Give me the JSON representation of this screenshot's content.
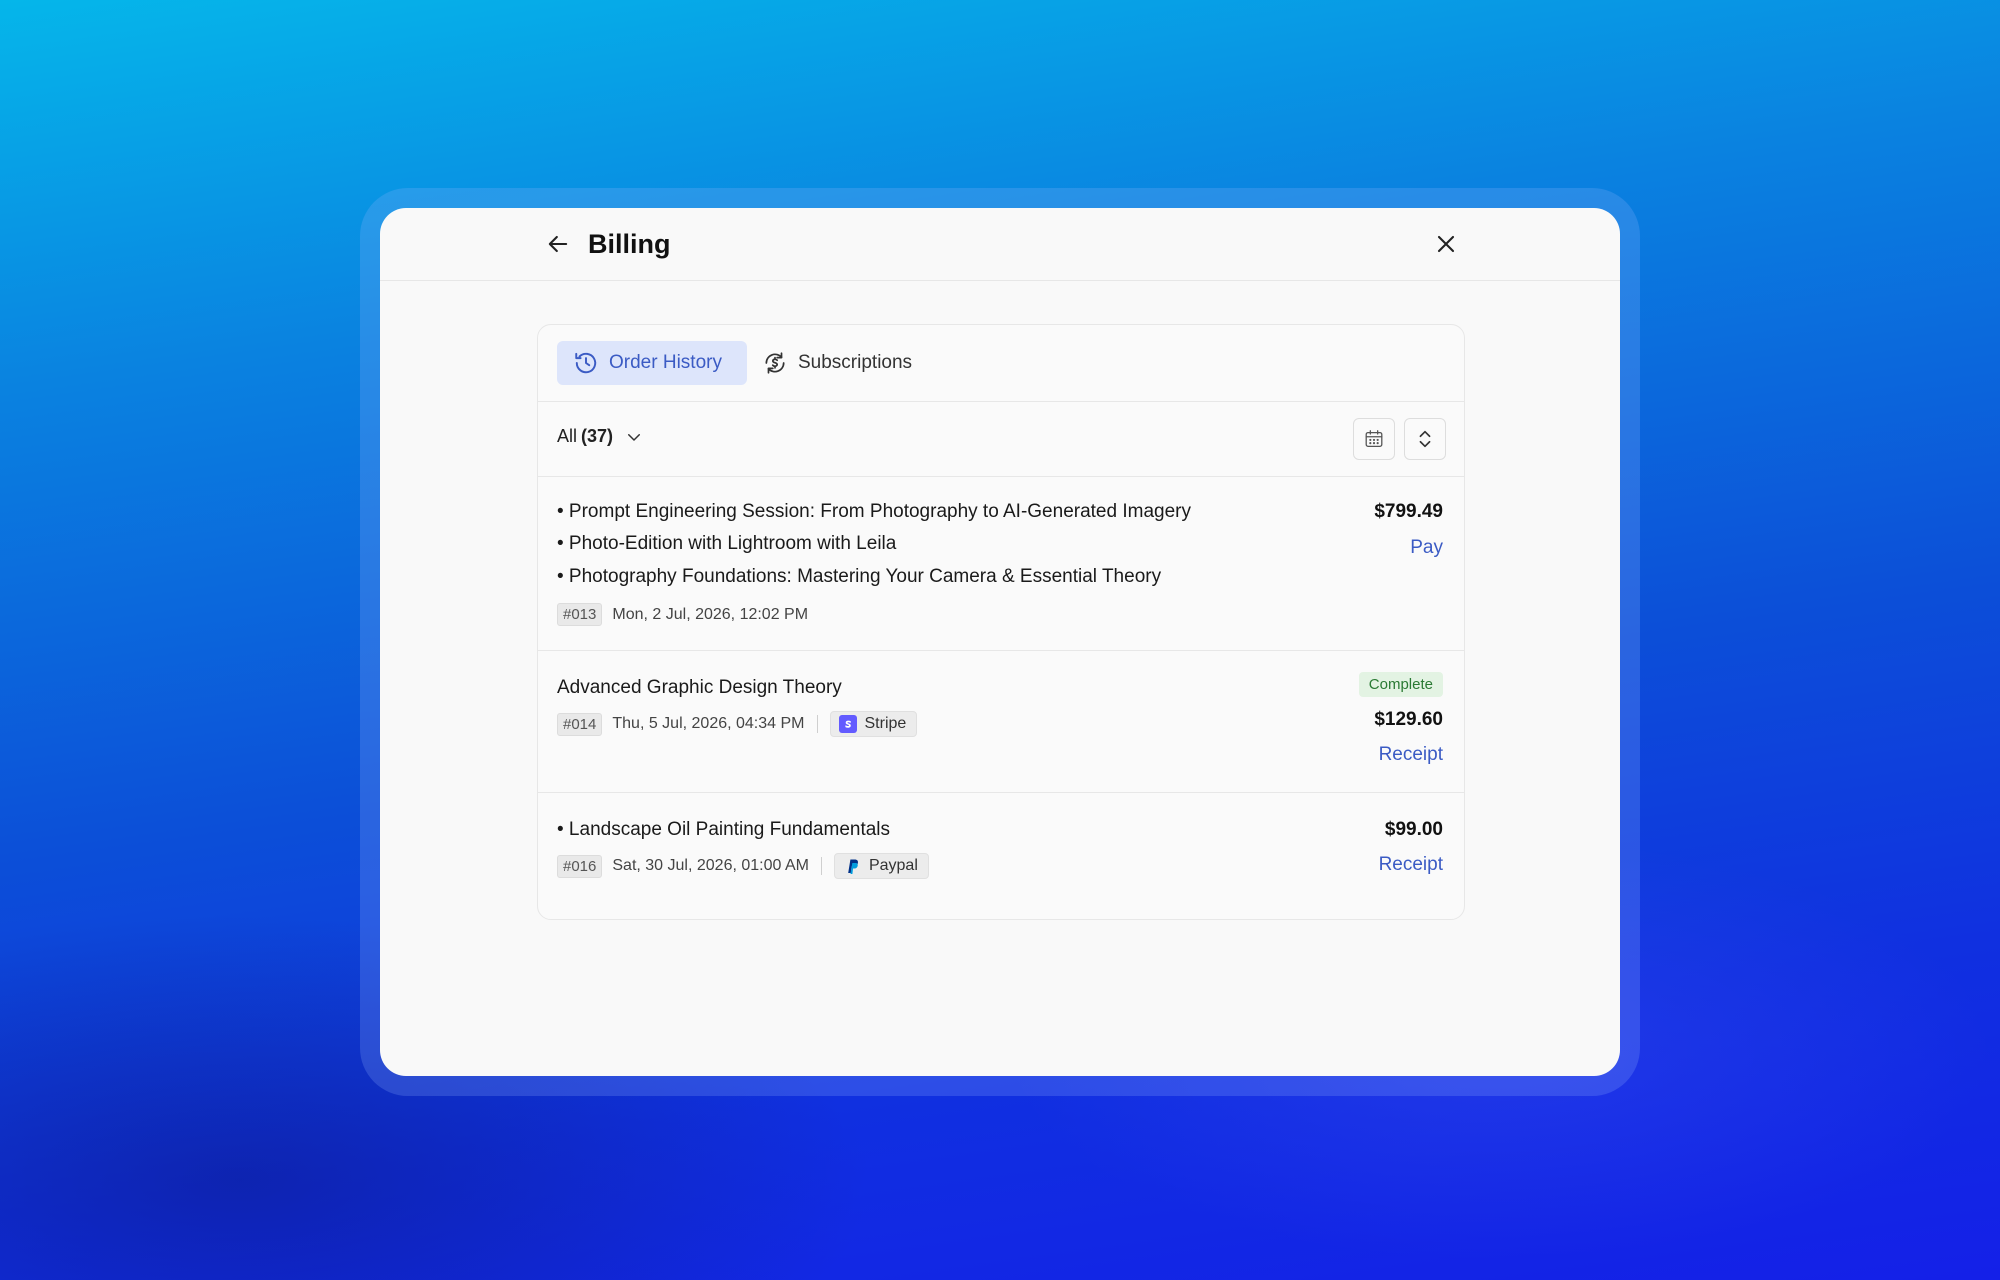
{
  "modal": {
    "title": "Billing"
  },
  "tabs": [
    {
      "label": "Order History",
      "active": true,
      "icon": "history-icon"
    },
    {
      "label": "Subscriptions",
      "active": false,
      "icon": "dollar-refresh-icon"
    }
  ],
  "filter": {
    "label": "All",
    "count": "(37)"
  },
  "orders": [
    {
      "items": [
        "• Prompt Engineering Session: From Photography to AI-Generated Imagery",
        "• Photo-Edition with Lightroom with Leila",
        "• Photography Foundations: Mastering Your Camera & Essential Theory"
      ],
      "id": "#013",
      "date": "Mon, 2 Jul, 2026, 12:02 PM",
      "amount": "$799.49",
      "action": "Pay"
    },
    {
      "items": [
        "Advanced Graphic Design Theory"
      ],
      "id": "#014",
      "date": "Thu, 5 Jul, 2026, 04:34 PM",
      "method": "Stripe",
      "status": "Complete",
      "amount": "$129.60",
      "action": "Receipt"
    },
    {
      "items": [
        "• Landscape Oil Painting Fundamentals"
      ],
      "id": "#016",
      "date": "Sat, 30 Jul, 2026, 01:00 AM",
      "method": "Paypal",
      "amount": "$99.00",
      "action": "Receipt"
    }
  ],
  "colors": {
    "accent": "#3b5bc4",
    "active_tab_bg": "#dde5fb",
    "complete_badge_bg": "#e3f3e3",
    "complete_badge_text": "#2a7a34",
    "stripe": "#635bff",
    "paypal": "#003087"
  }
}
